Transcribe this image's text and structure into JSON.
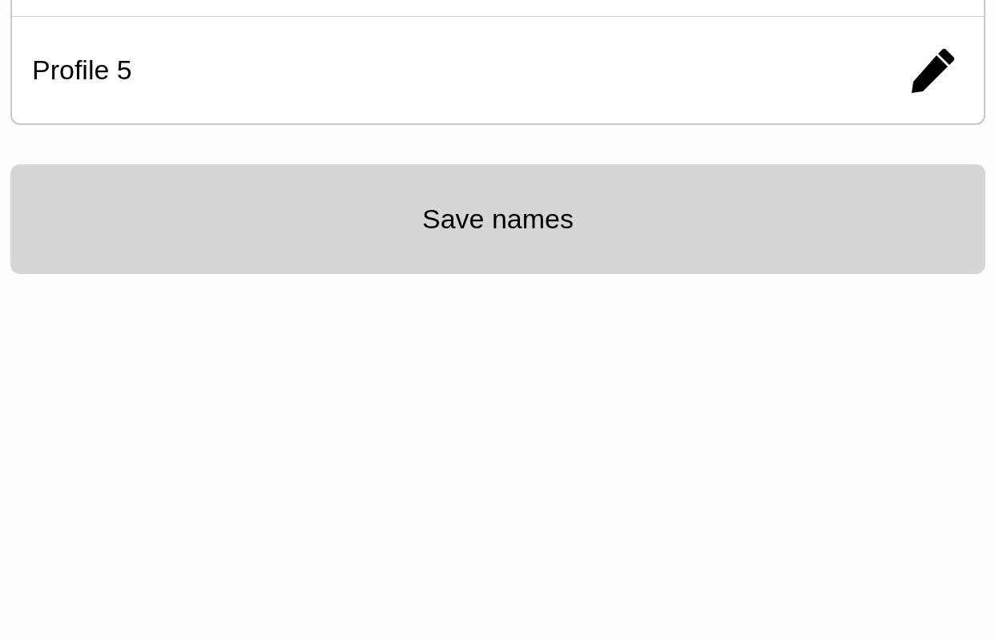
{
  "profiles": [
    {
      "name": "Profile 5"
    }
  ],
  "save_button": {
    "label": "Save names"
  }
}
